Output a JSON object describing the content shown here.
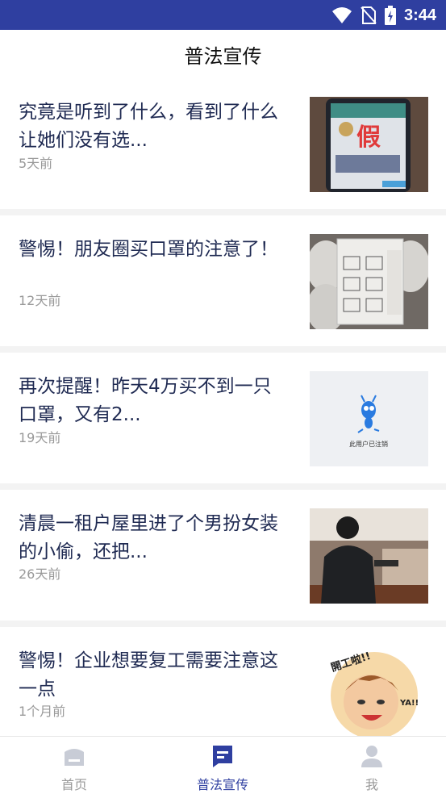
{
  "status_bar": {
    "time": "3:44"
  },
  "header": {
    "title": "普法宣传"
  },
  "articles": [
    {
      "title": "究竟是听到了什么，看到了什么让她们没有选...",
      "time": "5天前",
      "thumb": "phone-fake-app-photo",
      "thumb_text": "假"
    },
    {
      "title": "警惕！朋友圈买口罩的注意了！",
      "time": "12天前",
      "thumb": "mask-package-photo"
    },
    {
      "title": "再次提醒！昨天4万买不到一只口罩，又有2...",
      "time": "19天前",
      "thumb": "deregistered-user-placeholder",
      "thumb_text": "此用户已注销"
    },
    {
      "title": "清晨一租户屋里进了个男扮女装的小偷，还把...",
      "time": "26天前",
      "thumb": "room-photo"
    },
    {
      "title": "警惕！企业想要复工需要注意这一点",
      "time": "1个月前",
      "thumb": "cartoon-illustration",
      "thumb_text_1": "開工啦!!",
      "thumb_text_2": "YA!!"
    }
  ],
  "tab_bar": {
    "tabs": [
      {
        "label": "首页",
        "icon": "home-icon",
        "active": false
      },
      {
        "label": "普法宣传",
        "icon": "article-icon",
        "active": true
      },
      {
        "label": "我",
        "icon": "person-icon",
        "active": false
      }
    ],
    "active_color": "#2f3fa0",
    "inactive_color": "#999999"
  }
}
